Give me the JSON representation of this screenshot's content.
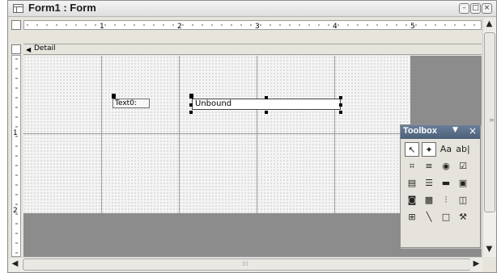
{
  "window": {
    "title": "Form1 : Form",
    "min_btn": "–",
    "max_btn": "□",
    "close_btn": "×"
  },
  "ruler": {
    "h_numbers": [
      "1",
      "2",
      "3",
      "4",
      "5"
    ],
    "v_numbers": [
      "1",
      "2"
    ]
  },
  "section": {
    "label": "Detail",
    "arrow": "◀"
  },
  "controls": {
    "label_text": "Text0:",
    "textbox_text": "Unbound"
  },
  "toolbox": {
    "title": "Toolbox",
    "menu_glyph": "▼",
    "close_glyph": "×",
    "tools": [
      {
        "name": "select-objects-tool",
        "glyph": "↖",
        "selected": true
      },
      {
        "name": "control-wizards-tool",
        "glyph": "✦",
        "selected": true
      },
      {
        "name": "label-tool",
        "glyph": "Aa",
        "selected": false
      },
      {
        "name": "text-box-tool",
        "glyph": "ab|",
        "selected": false
      },
      {
        "name": "option-group-tool",
        "glyph": "⌗",
        "selected": false
      },
      {
        "name": "toggle-button-tool",
        "glyph": "≡",
        "selected": false
      },
      {
        "name": "option-button-tool",
        "glyph": "◉",
        "selected": false
      },
      {
        "name": "check-box-tool",
        "glyph": "☑",
        "selected": false
      },
      {
        "name": "combo-box-tool",
        "glyph": "▤",
        "selected": false
      },
      {
        "name": "list-box-tool",
        "glyph": "☰",
        "selected": false
      },
      {
        "name": "command-button-tool",
        "glyph": "▬",
        "selected": false
      },
      {
        "name": "image-tool",
        "glyph": "▣",
        "selected": false
      },
      {
        "name": "unbound-object-frame-tool",
        "glyph": "◙",
        "selected": false
      },
      {
        "name": "bound-object-frame-tool",
        "glyph": "▩",
        "selected": false
      },
      {
        "name": "page-break-tool",
        "glyph": "⫶",
        "selected": false
      },
      {
        "name": "tab-control-tool",
        "glyph": "◫",
        "selected": false
      },
      {
        "name": "subform-tool",
        "glyph": "⊞",
        "selected": false
      },
      {
        "name": "line-tool",
        "glyph": "╲",
        "selected": false
      },
      {
        "name": "rectangle-tool",
        "glyph": "□",
        "selected": false
      },
      {
        "name": "more-controls-tool",
        "glyph": "⚒",
        "selected": false
      }
    ]
  },
  "scroll": {
    "up": "▲",
    "down": "▼",
    "left": "◀",
    "right": "▶",
    "grip_v": "≡",
    "grip_h": "⁞⁞⁞"
  }
}
